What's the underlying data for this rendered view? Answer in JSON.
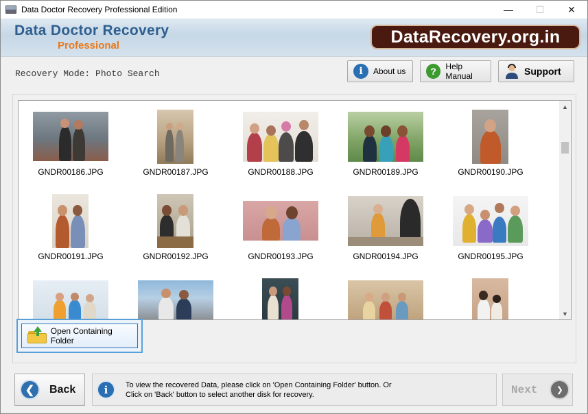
{
  "window": {
    "title": "Data Doctor Recovery Professional Edition",
    "minimize": "—",
    "maximize": "☐",
    "close": "✕"
  },
  "banner": {
    "brand": "Data Doctor Recovery",
    "edition": "Professional",
    "site": "DataRecovery.org.in"
  },
  "toolbar": {
    "mode": "Recovery Mode: Photo Search",
    "about": "About us",
    "help": "Help Manual",
    "support": "Support"
  },
  "gallery": {
    "files": [
      "GNDR00186.JPG",
      "GNDR00187.JPG",
      "GNDR00188.JPG",
      "GNDR00189.JPG",
      "GNDR00190.JPG",
      "GNDR00191.JPG",
      "GNDR00192.JPG",
      "GNDR00193.JPG",
      "GNDR00194.JPG",
      "GNDR00195.JPG"
    ]
  },
  "actions": {
    "open_folder": "Open Containing Folder",
    "back": "Back",
    "next": "Next"
  },
  "info": {
    "line1": "To view the recovered Data, please click on 'Open Containing Folder' button. Or",
    "line2": "Click on 'Back' button to select another disk for recovery."
  },
  "colors": {
    "brand_blue": "#2e5f8f",
    "brand_orange": "#e8791b",
    "badge_bg": "#4a1a10"
  }
}
